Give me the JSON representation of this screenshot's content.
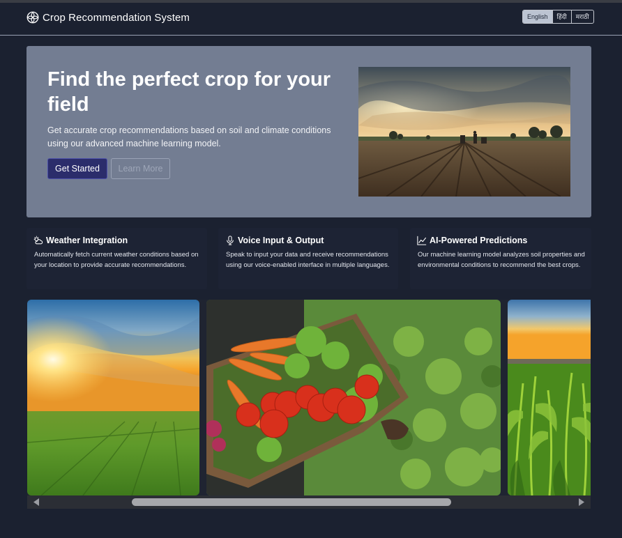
{
  "app": {
    "title": "Crop Recommendation System",
    "icon": "flower-logo-icon"
  },
  "languages": {
    "options": [
      "English",
      "हिंदी",
      "मराठी"
    ],
    "selected": "English"
  },
  "hero": {
    "title": "Find the perfect crop for your field",
    "description": "Get accurate crop recommendations based on soil and climate conditions using our advanced machine learning model.",
    "primary_button": "Get Started",
    "secondary_button": "Learn More"
  },
  "features": [
    {
      "icon": "weather-icon",
      "title": "Weather Integration",
      "text": "Automatically fetch current weather conditions based on your location to provide accurate recommendations."
    },
    {
      "icon": "microphone-icon",
      "title": "Voice Input & Output",
      "text": "Speak to input your data and receive recommendations using our voice-enabled interface in multiple languages."
    },
    {
      "icon": "chart-line-icon",
      "title": "AI-Powered Predictions",
      "text": "Our machine learning model analyzes soil properties and environmental conditions to recommend the best crops."
    }
  ],
  "colors": {
    "page_bg": "#1b2130",
    "hero_bg": "#737d92",
    "primary_button": "#2b2d6b",
    "card_bg": "#1d2334"
  }
}
